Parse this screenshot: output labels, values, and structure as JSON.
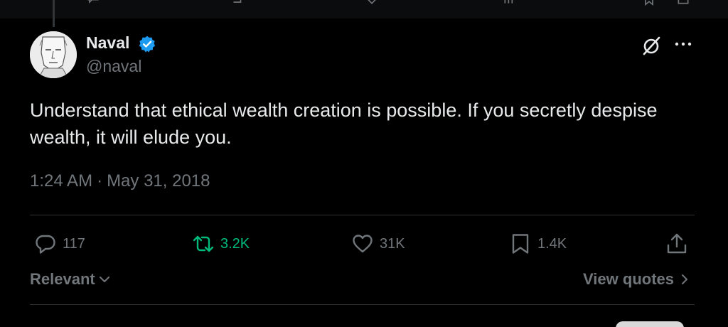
{
  "tweet": {
    "author_name": "Naval",
    "author_handle": "@naval",
    "text": "Understand that ethical wealth creation is possible. If you secretly despise wealth, it will elude you.",
    "time": "1:24 AM",
    "separator": "·",
    "date": "May 31, 2018"
  },
  "actions": {
    "replies": "117",
    "reposts": "3.2K",
    "likes": "31K",
    "bookmarks": "1.4K"
  },
  "footer": {
    "sort_label": "Relevant",
    "view_quotes_label": "View quotes"
  },
  "colors": {
    "background": "#000000",
    "text": "#e7e9ea",
    "muted": "#71767b",
    "repost_accent": "#00ba7c",
    "verified_blue": "#1d9bf0",
    "divider": "#2f3336"
  },
  "icons": [
    "reply-icon",
    "repost-icon",
    "like-icon",
    "bookmark-icon",
    "share-icon",
    "verified-badge-icon",
    "grok-icon",
    "more-icon",
    "chevron-down-icon",
    "chevron-right-icon"
  ]
}
